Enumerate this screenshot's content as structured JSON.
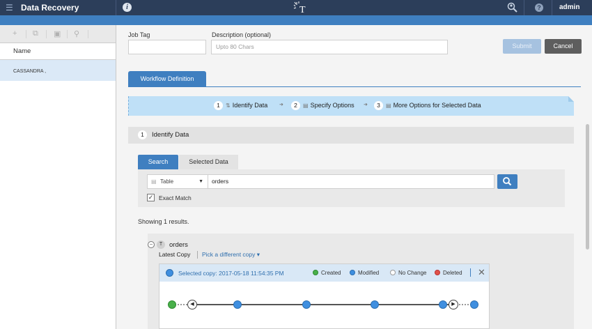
{
  "header": {
    "menu_icon": "hamburger-icon",
    "title": "Data Recovery",
    "info_icon": "info-icon",
    "logo_letter": "T",
    "search_user_icon": "search-user-icon",
    "help_icon": "help-icon",
    "help_glyph": "?",
    "user": "admin"
  },
  "sidebar": {
    "toolbar_icons": [
      "add-icon",
      "copy-icon",
      "delete-icon",
      "search-icon"
    ],
    "column_header": "Name",
    "items": [
      {
        "label": "CASSANDRA ,"
      }
    ]
  },
  "form": {
    "job_tag_label": "Job Tag",
    "job_tag_value": "",
    "description_label": "Description (optional)",
    "description_placeholder": "Upto 80 Chars",
    "submit_label": "Submit",
    "cancel_label": "Cancel"
  },
  "workflow": {
    "tab_label": "Workflow Definition",
    "steps": [
      {
        "num": "1",
        "label": "Identify Data"
      },
      {
        "num": "2",
        "label": "Specify Options"
      },
      {
        "num": "3",
        "label": "More Options for Selected Data"
      }
    ]
  },
  "identify": {
    "num": "1",
    "title": "Identify Data",
    "tabs": [
      "Search",
      "Selected Data"
    ],
    "type_select": "Table",
    "search_value": "orders",
    "exact_match_label": "Exact Match",
    "exact_match_checked": true,
    "results_text": "Showing 1 results."
  },
  "result": {
    "type_badge": "T",
    "name": "orders",
    "latest_copy_label": "Latest Copy",
    "pick_copy_label": "Pick a different copy",
    "selected_copy_text": "Selected copy: 2017-05-18 11:54:35 PM",
    "legend": [
      {
        "label": "Created",
        "color": "#49b04a"
      },
      {
        "label": "Modified",
        "color": "#3f8fe0"
      },
      {
        "label": "No Change",
        "color": "#ffffff"
      },
      {
        "label": "Deleted",
        "color": "#e0524a"
      }
    ],
    "close_glyph": "✕"
  },
  "colors": {
    "topbar": "#2c3e5a",
    "accent": "#3f7fc0",
    "steps_bg": "#bfe0f7"
  }
}
